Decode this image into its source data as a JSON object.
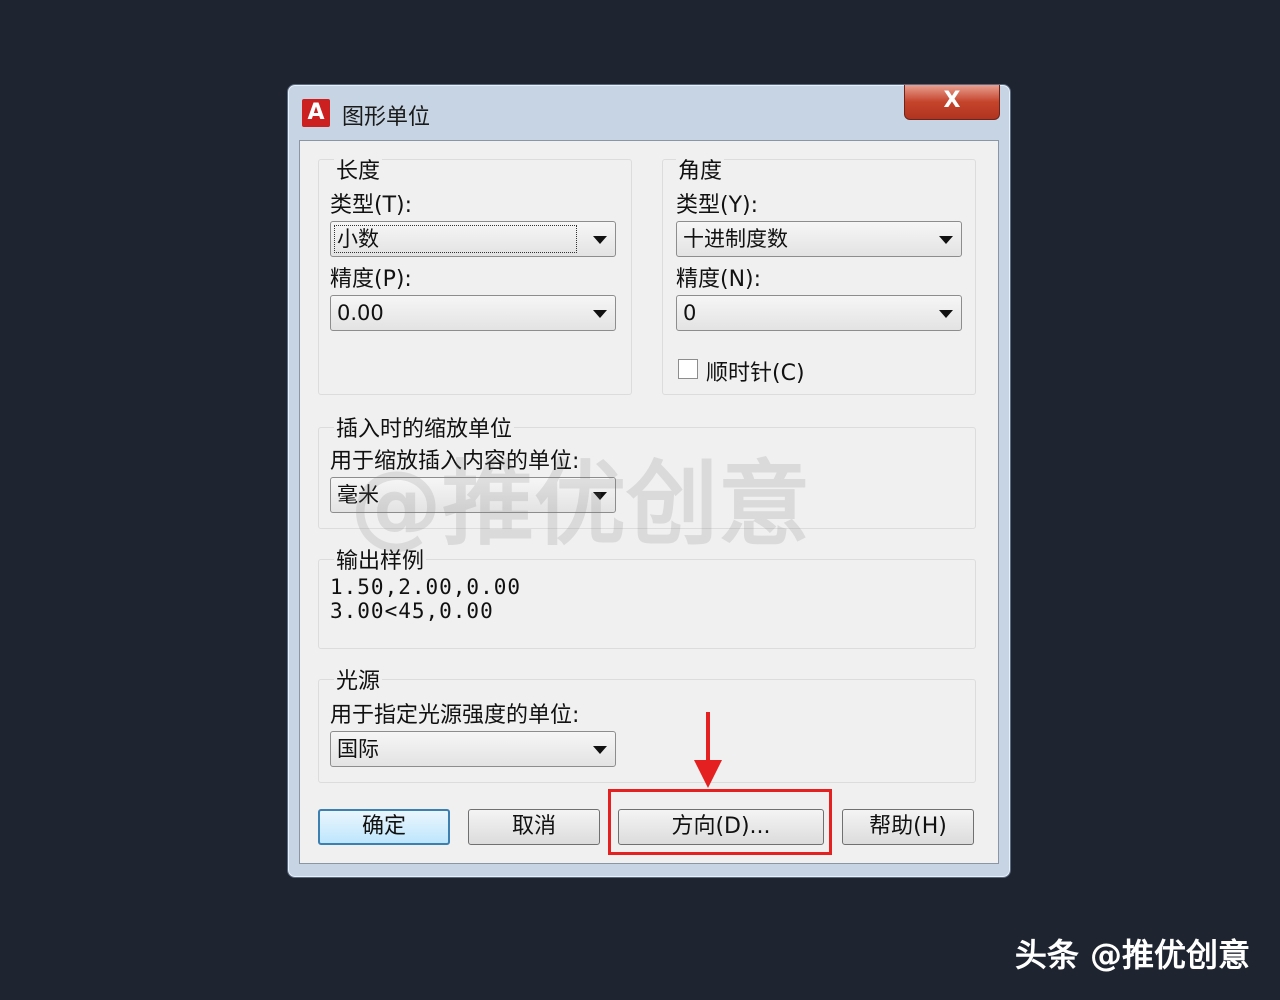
{
  "window": {
    "title": "图形单位",
    "app_icon": "A",
    "close_label": "X"
  },
  "length": {
    "group_label": "长度",
    "type_label": "类型(T):",
    "type_value": "小数",
    "precision_label": "精度(P):",
    "precision_value": "0.00"
  },
  "angle": {
    "group_label": "角度",
    "type_label": "类型(Y):",
    "type_value": "十进制度数",
    "precision_label": "精度(N):",
    "precision_value": "0",
    "clockwise_label": "顺时针(C)",
    "clockwise_checked": false
  },
  "insert_scale": {
    "group_label": "插入时的缩放单位",
    "desc": "用于缩放插入内容的单位:",
    "value": "毫米"
  },
  "sample_output": {
    "group_label": "输出样例",
    "line1": "1.50,2.00,0.00",
    "line2": "3.00<45,0.00"
  },
  "lighting": {
    "group_label": "光源",
    "desc": "用于指定光源强度的单位:",
    "value": "国际"
  },
  "buttons": {
    "ok": "确定",
    "cancel": "取消",
    "direction": "方向(D)...",
    "help": "帮助(H)"
  },
  "watermark": "@推优创意",
  "credit": "头条 @推优创意",
  "colors": {
    "highlight": "#e52020",
    "background": "#1f2530"
  }
}
